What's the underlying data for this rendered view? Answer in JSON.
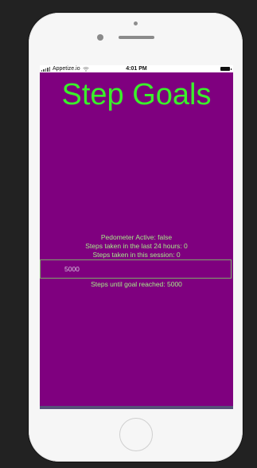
{
  "status_bar": {
    "carrier": "Appetize.io",
    "time": "4:01 PM"
  },
  "app": {
    "title": "Step Goals",
    "pedometer_status": "Pedometer Active: false",
    "steps_24h": "Steps taken in the last 24 hours: 0",
    "steps_session": "Steps taken in this session: 0",
    "goal_input_value": "5000",
    "steps_until_goal": "Steps until goal reached: 5000"
  },
  "icons": {
    "signal": "signal-strength-icon",
    "wifi": "wifi-icon",
    "battery": "battery-icon"
  },
  "colors": {
    "background": "#7f007f",
    "title": "#3af12a",
    "text": "#a6e889"
  }
}
